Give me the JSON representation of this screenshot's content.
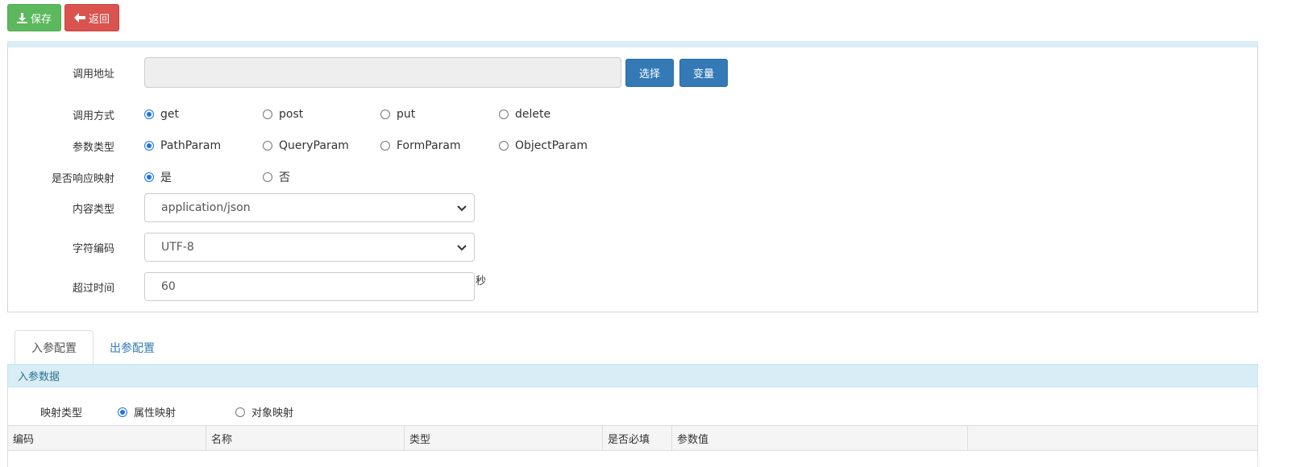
{
  "toolbar": {
    "save_label": "保存",
    "back_label": "返回"
  },
  "form": {
    "url": {
      "label": "调用地址",
      "value": "",
      "select_btn": "选择",
      "variable_btn": "变量"
    },
    "method": {
      "label": "调用方式",
      "options": [
        "get",
        "post",
        "put",
        "delete"
      ],
      "selected": "get"
    },
    "param_type": {
      "label": "参数类型",
      "options": [
        "PathParam",
        "QueryParam",
        "FormParam",
        "ObjectParam"
      ],
      "selected": "PathParam"
    },
    "response_mapping": {
      "label": "是否响应映射",
      "options": [
        "是",
        "否"
      ],
      "selected": "是"
    },
    "content_type": {
      "label": "内容类型",
      "value": "application/json"
    },
    "charset": {
      "label": "字符编码",
      "value": "UTF-8"
    },
    "timeout": {
      "label": "超过时间",
      "value": "60",
      "unit": "秒"
    }
  },
  "tabs": [
    {
      "label": "入参配置",
      "active": true
    },
    {
      "label": "出参配置",
      "active": false
    }
  ],
  "params": {
    "header": "入参数据",
    "mapping_type": {
      "label": "映射类型",
      "options": [
        "属性映射",
        "对象映射"
      ],
      "selected": "属性映射"
    },
    "columns": [
      "编码",
      "名称",
      "类型",
      "是否必填",
      "参数值",
      ""
    ]
  },
  "colors": {
    "success": "#5cb85c",
    "danger": "#d9534f",
    "primary": "#337ab7",
    "panel_header": "#d9edf7"
  }
}
